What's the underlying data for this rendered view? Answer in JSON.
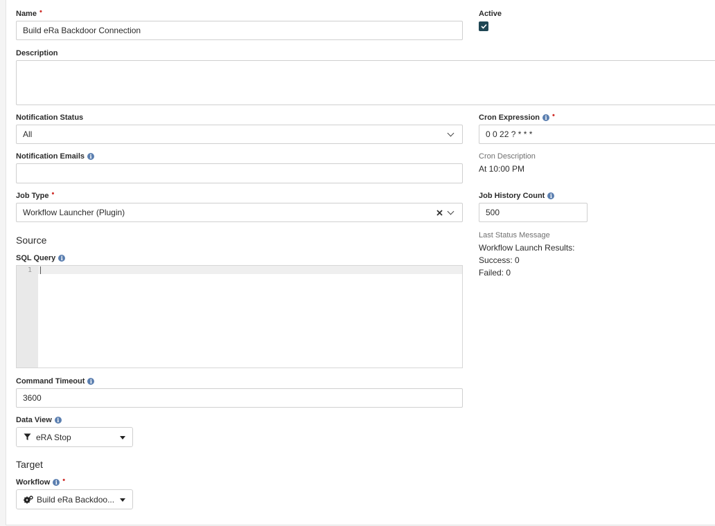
{
  "form": {
    "name": {
      "label": "Name",
      "value": "Build eRa Backdoor Connection"
    },
    "active": {
      "label": "Active",
      "checked": true
    },
    "description": {
      "label": "Description",
      "value": ""
    },
    "notification_status": {
      "label": "Notification Status",
      "value": "All"
    },
    "cron_expression": {
      "label": "Cron Expression",
      "value": "0 0 22 ? * * *"
    },
    "notification_emails": {
      "label": "Notification Emails",
      "value": ""
    },
    "cron_description": {
      "label": "Cron Description",
      "value": "At 10:00 PM"
    },
    "job_type": {
      "label": "Job Type",
      "value": "Workflow Launcher (Plugin)"
    },
    "job_history_count": {
      "label": "Job History Count",
      "value": "500"
    },
    "last_status": {
      "label": "Last Status Message",
      "lines": [
        "Workflow Launch Results:",
        "Success: 0",
        "Failed: 0"
      ]
    },
    "source_heading": "Source",
    "sql_query": {
      "label": "SQL Query",
      "line_number": "1"
    },
    "command_timeout": {
      "label": "Command Timeout",
      "value": "3600"
    },
    "data_view": {
      "label": "Data View",
      "value": "eRA Stop"
    },
    "target_heading": "Target",
    "workflow": {
      "label": "Workflow",
      "value": "Build eRa Backdoo..."
    }
  },
  "icons": {
    "info": "info-circle-icon",
    "filter": "filter-icon",
    "gears": "gears-icon",
    "clear": "clear-x-icon",
    "check": "checkmark-icon"
  },
  "colors": {
    "required": "#d0312d",
    "info": "#5b7fb0",
    "checkbox": "#1f4654"
  }
}
